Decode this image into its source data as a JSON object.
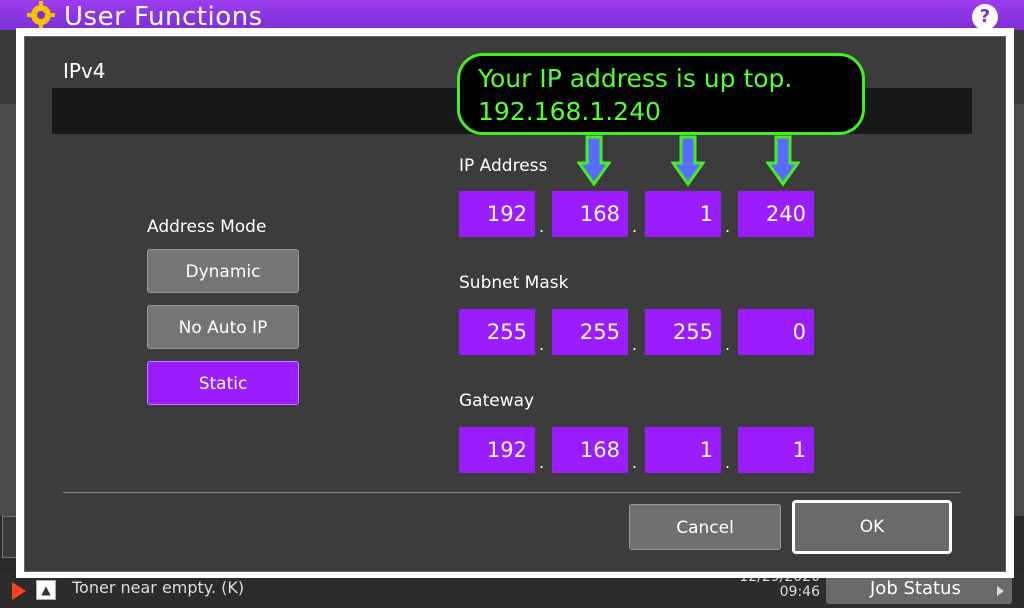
{
  "topbar": {
    "title": "User Functions",
    "help_label": "?"
  },
  "dialog": {
    "title": "IPv4",
    "address_mode": {
      "label": "Address Mode",
      "options": [
        "Dynamic",
        "No Auto IP",
        "Static"
      ],
      "selected": "Static"
    },
    "ip_address": {
      "label": "IP Address",
      "octets": [
        "192",
        "168",
        "1",
        "240"
      ]
    },
    "subnet_mask": {
      "label": "Subnet Mask",
      "octets": [
        "255",
        "255",
        "255",
        "0"
      ]
    },
    "gateway": {
      "label": "Gateway",
      "octets": [
        "192",
        "168",
        "1",
        "1"
      ]
    },
    "separator": ".",
    "cancel_label": "Cancel",
    "ok_label": "OK"
  },
  "callout": {
    "line1": "Your IP address is up top.",
    "line2": "192.168.1.240"
  },
  "statusbar": {
    "message": "Toner near empty. (K)",
    "date": "12/29/2020",
    "time": "09:46",
    "job_status_label": "Job Status"
  },
  "colors": {
    "accent": "#9b1cff",
    "callout_green": "#44ee22",
    "arrow_blue": "#5a6cff"
  }
}
